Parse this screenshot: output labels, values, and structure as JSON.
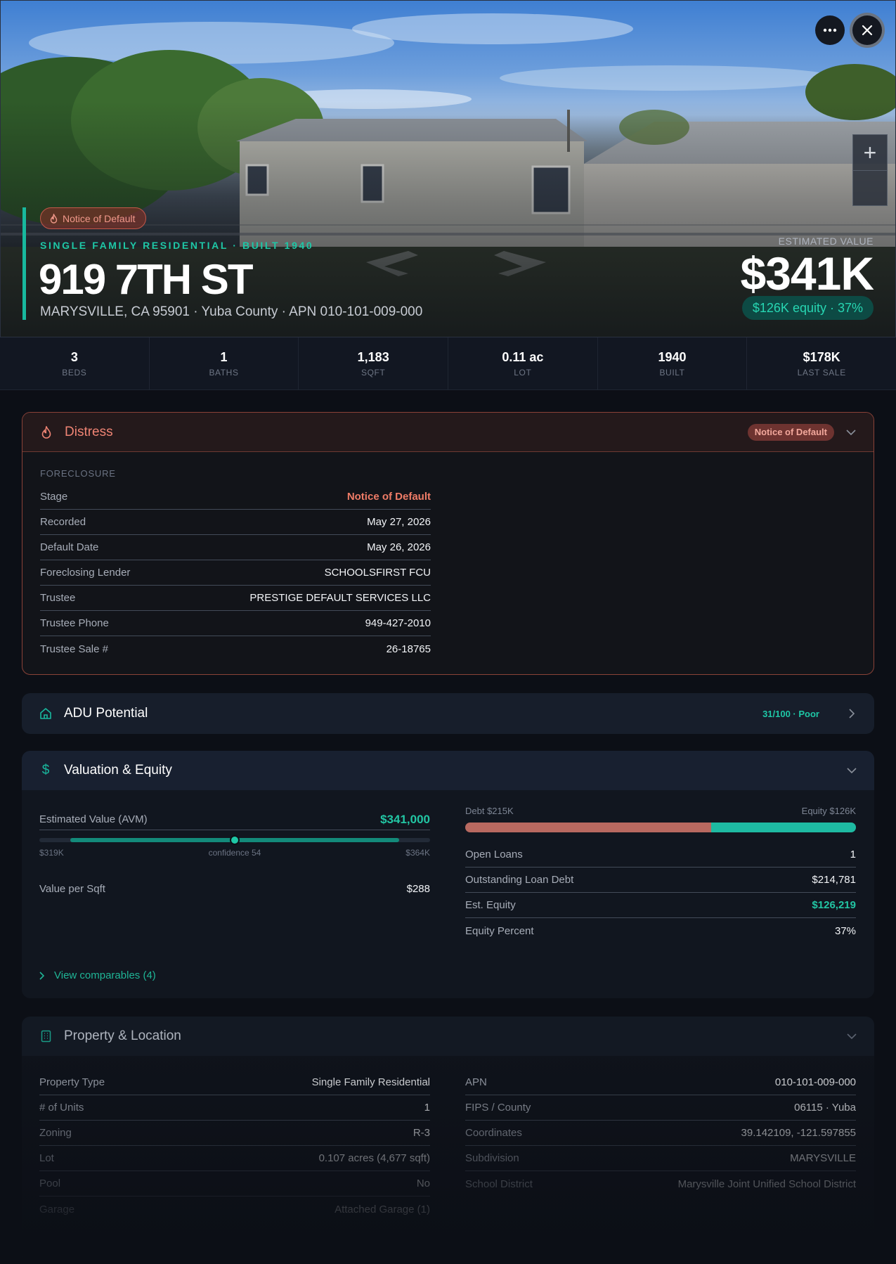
{
  "hero": {
    "more_icon": "more-horizontal-icon",
    "close_icon": "close-icon",
    "zoom_in_label": "+",
    "badge": "Notice of Default",
    "type_line": "SINGLE FAMILY RESIDENTIAL · BUILT 1940",
    "address": "919 7TH ST",
    "sub_line": "MARYSVILLE, CA 95901 · Yuba County · APN 010-101-009-000",
    "estimated_label": "ESTIMATED VALUE",
    "estimated_value": "$341K",
    "equity_pill": "$126K equity · 37%"
  },
  "stats": [
    {
      "value": "3",
      "label": "BEDS"
    },
    {
      "value": "1",
      "label": "BATHS"
    },
    {
      "value": "1,183",
      "label": "SQFT"
    },
    {
      "value": "0.11 ac",
      "label": "LOT"
    },
    {
      "value": "1940",
      "label": "BUILT"
    },
    {
      "value": "$178K",
      "label": "LAST SALE"
    }
  ],
  "distress": {
    "title": "Distress",
    "badge": "Notice of Default",
    "section": "FORECLOSURE",
    "rows": [
      {
        "k": "Stage",
        "v": "Notice of Default"
      },
      {
        "k": "Recorded",
        "v": "May 27, 2026"
      },
      {
        "k": "Default Date",
        "v": "May 26, 2026"
      },
      {
        "k": "Foreclosing Lender",
        "v": "SCHOOLSFIRST FCU"
      },
      {
        "k": "Trustee",
        "v": "PRESTIGE DEFAULT SERVICES LLC"
      },
      {
        "k": "Trustee Phone",
        "v": "949-427-2010"
      },
      {
        "k": "Trustee Sale #",
        "v": "26-18765"
      }
    ]
  },
  "adu": {
    "title": "ADU Potential",
    "score": "31/100 · Poor"
  },
  "valuation": {
    "title": "Valuation & Equity",
    "avm_label": "Estimated Value (AVM)",
    "avm_value": "$341,000",
    "range_low": "$319K",
    "range_mid": "confidence 54",
    "range_high": "$364K",
    "range_fill_start": 0.08,
    "range_fill_end": 0.92,
    "range_marker": 0.5,
    "vps_label": "Value per Sqft",
    "vps_value": "$288",
    "debt_label": "Debt $215K",
    "equity_label": "Equity $126K",
    "debt_share": 0.63,
    "rows": [
      {
        "k": "Open Loans",
        "v": "1",
        "teal": false
      },
      {
        "k": "Outstanding Loan Debt",
        "v": "$214,781",
        "teal": false
      },
      {
        "k": "Est. Equity",
        "v": "$126,219",
        "teal": true
      },
      {
        "k": "Equity Percent",
        "v": "37%",
        "teal": false
      }
    ],
    "comps_link": "View comparables (4)"
  },
  "property": {
    "title": "Property & Location",
    "left": [
      {
        "k": "Property Type",
        "v": "Single Family Residential"
      },
      {
        "k": "# of Units",
        "v": "1"
      },
      {
        "k": "Zoning",
        "v": "R-3"
      },
      {
        "k": "Lot",
        "v": "0.107 acres (4,677 sqft)"
      },
      {
        "k": "Pool",
        "v": "No"
      },
      {
        "k": "Garage",
        "v": "Attached Garage (1)"
      }
    ],
    "right": [
      {
        "k": "APN",
        "v": "010-101-009-000"
      },
      {
        "k": "FIPS / County",
        "v": "06115 · Yuba"
      },
      {
        "k": "Coordinates",
        "v": "39.142109, -121.597855"
      },
      {
        "k": "Subdivision",
        "v": "MARYSVILLE"
      },
      {
        "k": "School District",
        "v": "Marysville Joint Unified School District"
      }
    ]
  },
  "colors": {
    "accent": "#1ec7a6",
    "alert": "#ef7c67",
    "debt": "#b86960"
  }
}
